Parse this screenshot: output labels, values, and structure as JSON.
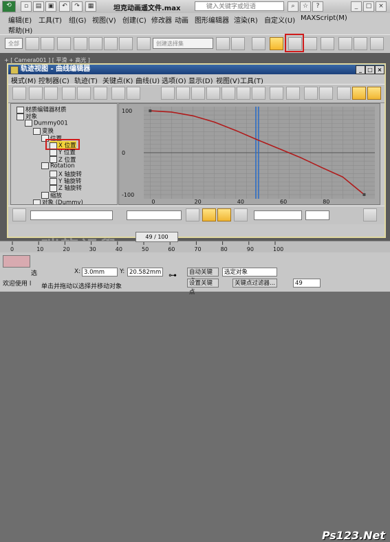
{
  "app": {
    "title": "坦克动画遥文件.max",
    "search_placeholder": "键入关键字或短语"
  },
  "menu": [
    "编辑(E)",
    "工具(T)",
    "组(G)",
    "视图(V)",
    "创建(C)",
    "修改器",
    "动画",
    "图形编辑器",
    "渲染(R)",
    "自定义(U)",
    "MAXScript(M)",
    "帮助(H)"
  ],
  "toolbar": {
    "selection_filter": "全部",
    "named_selection_placeholder": "创建选择集"
  },
  "viewport": {
    "label": "+ [ Camera001 ] [ 平滑 + 高光 ]"
  },
  "curve_editor": {
    "title": "轨迹视图 - 曲线编辑器",
    "menu": [
      "模式(M)",
      "控制器(C)",
      "轨迹(T)",
      "关键点(K)",
      "曲线(U)",
      "选项(O)",
      "显示(D)",
      "视图(V)",
      "工具(T)"
    ],
    "tree": [
      {
        "label": "材质编辑器材质",
        "indent": 0
      },
      {
        "label": "对象",
        "indent": 0
      },
      {
        "label": "Dummy001",
        "indent": 1
      },
      {
        "label": "变换",
        "indent": 2
      },
      {
        "label": "位置",
        "indent": 3
      },
      {
        "label": "X 位置",
        "indent": 4,
        "selected": true
      },
      {
        "label": "Y 位置",
        "indent": 4
      },
      {
        "label": "Z 位置",
        "indent": 4
      },
      {
        "label": "Rotation",
        "indent": 3
      },
      {
        "label": "X 轴旋转",
        "indent": 4
      },
      {
        "label": "Y 轴旋转",
        "indent": 4
      },
      {
        "label": "Z 轴旋转",
        "indent": 4
      },
      {
        "label": "缩放",
        "indent": 3
      },
      {
        "label": "对象 (Dummy)",
        "indent": 2
      }
    ],
    "curve_color": "#b01a1a",
    "time_marker_color": "#2a6dc8"
  },
  "chart_data": {
    "type": "line",
    "series": [
      {
        "name": "X 位置",
        "x": [
          0,
          10,
          20,
          30,
          40,
          50,
          60,
          70,
          80,
          90,
          100
        ],
        "y": [
          100,
          97,
          88,
          73,
          53,
          31,
          10,
          -11,
          -35,
          -58,
          -100
        ]
      }
    ],
    "x_ticks": [
      0,
      20,
      40,
      60,
      80
    ],
    "y_ticks": [
      100,
      0,
      -100
    ],
    "xlim": [
      -3,
      105
    ],
    "ylim": [
      -110,
      110
    ],
    "time_slider": 50,
    "grid": true
  },
  "timeline": {
    "frame_display": "49 / 100",
    "ticks": [
      "0",
      "10",
      "20",
      "30",
      "40",
      "50",
      "60",
      "70",
      "80",
      "90",
      "100"
    ]
  },
  "status": {
    "prompt_label": "欢迎使用 l",
    "selected_text": "选",
    "x_label": "X:",
    "x_value": "3.0mm",
    "y_label": "Y:",
    "y_value": "20.582mm",
    "hint": "单击并拖动以选择并移动对象",
    "auto_key": "自动关键点",
    "set_key": "设置关键点",
    "selected_object": "选定对象",
    "key_filters": "关键点过滤器...",
    "frame_value": "49"
  },
  "watermark": "瑞龍視覺 WWW.TLVI.NET",
  "site_badge": "Ps123.Net"
}
